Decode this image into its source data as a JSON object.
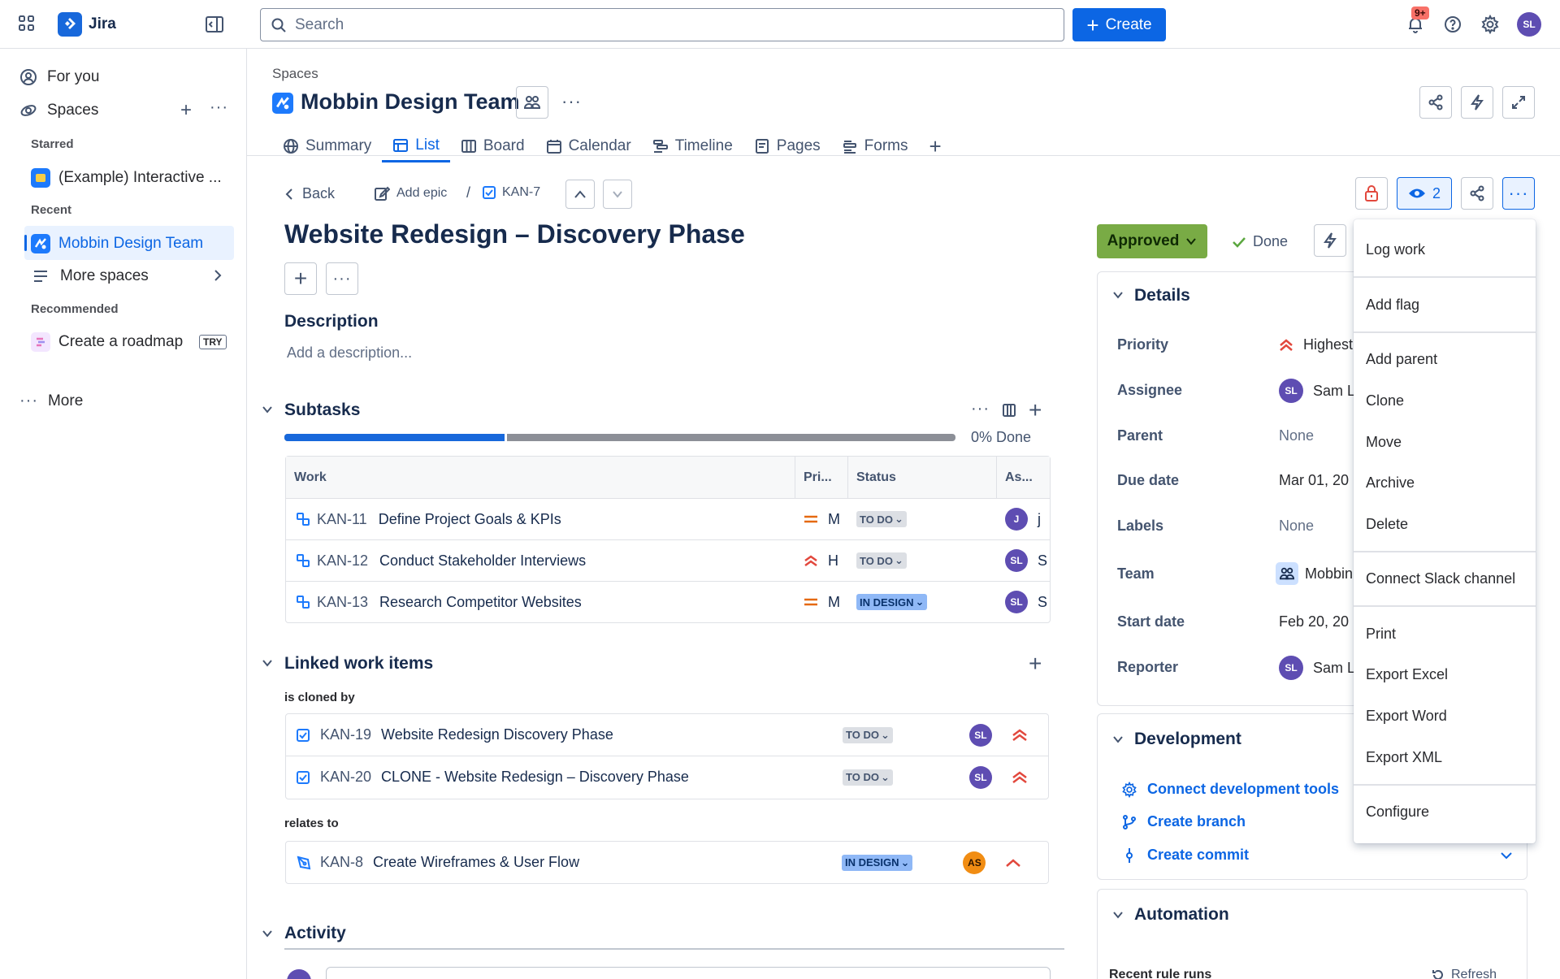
{
  "app": {
    "name": "Jira"
  },
  "topbar": {
    "search_placeholder": "Search",
    "create_label": "Create",
    "notifications_badge": "9+",
    "user_initials": "SL"
  },
  "sidebar": {
    "for_you": "For you",
    "spaces": "Spaces",
    "starred_heading": "Starred",
    "starred_item": "(Example) Interactive ...",
    "recent_heading": "Recent",
    "recent_item": "Mobbin Design Team",
    "more_spaces": "More spaces",
    "recommended_heading": "Recommended",
    "recommended_item": "Create a roadmap",
    "try_badge": "TRY",
    "more": "More"
  },
  "header": {
    "breadcrumb": "Spaces",
    "space_title": "Mobbin Design Team",
    "tabs": [
      "Summary",
      "List",
      "Board",
      "Calendar",
      "Timeline",
      "Pages",
      "Forms"
    ],
    "active_tab": "List"
  },
  "issue": {
    "back": "Back",
    "add_epic": "Add epic",
    "key": "KAN-7",
    "title": "Website Redesign – Discovery Phase",
    "watchers": "2",
    "status": "Approved",
    "done_label": "Done",
    "description_heading": "Description",
    "description_placeholder": "Add a description..."
  },
  "subtasks": {
    "heading": "Subtasks",
    "progress_label": "0% Done",
    "progress_done_fraction": 0.0,
    "columns": [
      "Work",
      "Pri...",
      "Status",
      "As..."
    ],
    "rows": [
      {
        "key": "KAN-11",
        "summary": "Define Project Goals & KPIs",
        "priority": "M",
        "status": "TO DO",
        "assignee": "J",
        "assignee_text": "j"
      },
      {
        "key": "KAN-12",
        "summary": "Conduct Stakeholder Interviews",
        "priority": "H",
        "status": "TO DO",
        "assignee": "SL",
        "assignee_text": "S"
      },
      {
        "key": "KAN-13",
        "summary": "Research Competitor Websites",
        "priority": "M",
        "status": "IN DESIGN",
        "assignee": "SL",
        "assignee_text": "S"
      }
    ]
  },
  "linked": {
    "heading": "Linked work items",
    "groups": [
      {
        "relation": "is cloned by",
        "items": [
          {
            "key": "KAN-19",
            "summary": "Website Redesign Discovery Phase",
            "status": "TO DO",
            "assignee": "SL"
          },
          {
            "key": "KAN-20",
            "summary": "CLONE - Website Redesign – Discovery Phase",
            "status": "TO DO",
            "assignee": "SL"
          }
        ]
      },
      {
        "relation": "relates to",
        "items": [
          {
            "key": "KAN-8",
            "summary": "Create Wireframes & User Flow",
            "status": "IN DESIGN",
            "assignee": "AS"
          }
        ]
      }
    ]
  },
  "activity": {
    "heading": "Activity"
  },
  "details": {
    "heading": "Details",
    "fields": [
      {
        "label": "Priority",
        "value": "Highest"
      },
      {
        "label": "Assignee",
        "value": "Sam L",
        "avatar": "SL"
      },
      {
        "label": "Parent",
        "value": "None"
      },
      {
        "label": "Due date",
        "value": "Mar 01, 20"
      },
      {
        "label": "Labels",
        "value": "None"
      },
      {
        "label": "Team",
        "value": "Mobbin"
      },
      {
        "label": "Start date",
        "value": "Feb 20, 20"
      },
      {
        "label": "Reporter",
        "value": "Sam L",
        "avatar": "SL"
      }
    ]
  },
  "development": {
    "heading": "Development",
    "connect": "Connect development tools",
    "branch": "Create branch",
    "commit": "Create commit"
  },
  "automation": {
    "heading": "Automation",
    "recent_runs": "Recent rule runs",
    "refresh": "Refresh"
  },
  "menu": {
    "items": [
      "Log work",
      "Add flag",
      "Add parent",
      "Clone",
      "Move",
      "Archive",
      "Delete",
      "Connect Slack channel",
      "Print",
      "Export Excel",
      "Export Word",
      "Export XML",
      "Configure"
    ]
  },
  "colors": {
    "accent": "#0c66e4",
    "approved": "#79ab45",
    "priority_high": "#e2483d",
    "priority_medium": "#e56910"
  }
}
